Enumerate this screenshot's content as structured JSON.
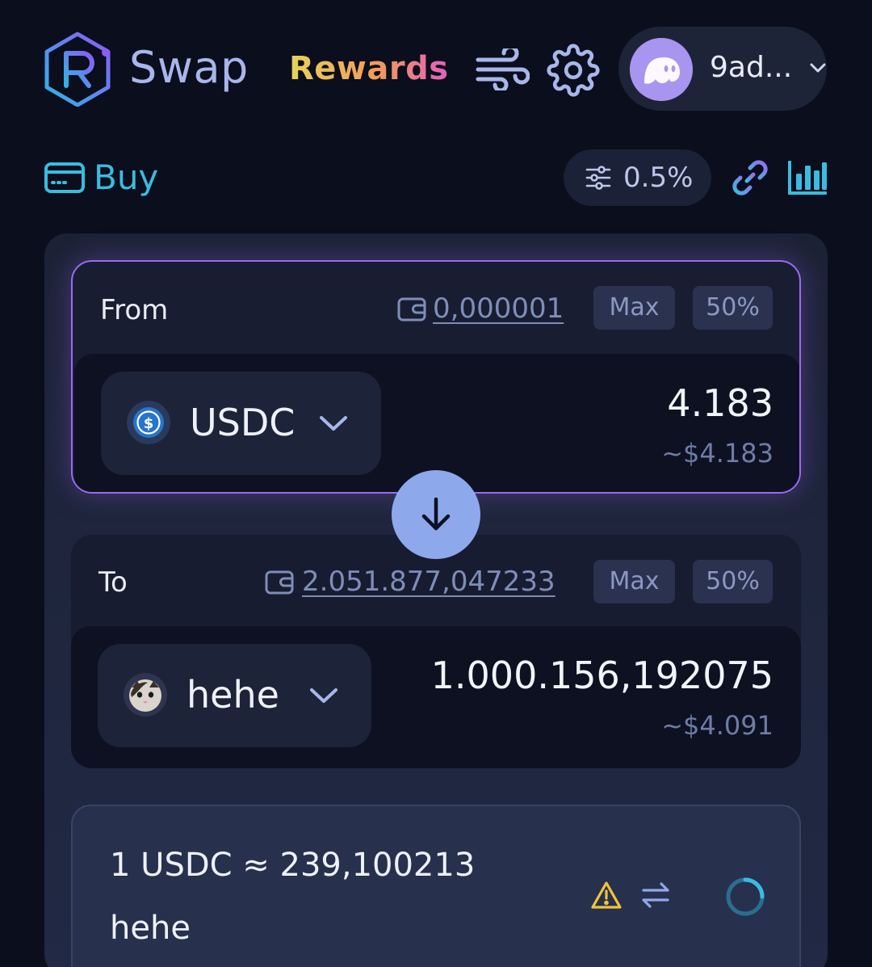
{
  "header": {
    "brand": "Swap",
    "rewards": "Rewards",
    "wallet": {
      "name": "9ad..."
    }
  },
  "subheader": {
    "buy": "Buy",
    "slippage": "0.5%"
  },
  "from": {
    "label": "From",
    "balance": "0,000001",
    "max": "Max",
    "half": "50%",
    "token": "USDC",
    "amount": "4.183",
    "usd": "~$4.183"
  },
  "to": {
    "label": "To",
    "balance": "2.051.877,047233",
    "max": "Max",
    "half": "50%",
    "token": "hehe",
    "amount": "1.000.156,192075",
    "usd": "~$4.091"
  },
  "rate": {
    "line1": "1 USDC ≈ 239,100213",
    "line2": "hehe"
  },
  "colors": {
    "background": "#0b0e1c",
    "accent_purple": "#9b6af0",
    "swap_button": "#8ea8ec",
    "buy_cyan": "#38bde0",
    "warning": "#f0c43c"
  },
  "icons": [
    "raydium-logo-icon",
    "wind-icon",
    "gear-icon",
    "ghost-avatar-icon",
    "chevron-down-icon",
    "credit-card-icon",
    "sliders-icon",
    "link-icon",
    "bar-chart-icon",
    "wallet-icon",
    "usdc-token-icon",
    "cat-token-icon",
    "arrow-down-icon",
    "warning-icon",
    "swap-arrows-icon",
    "spinner-icon"
  ]
}
